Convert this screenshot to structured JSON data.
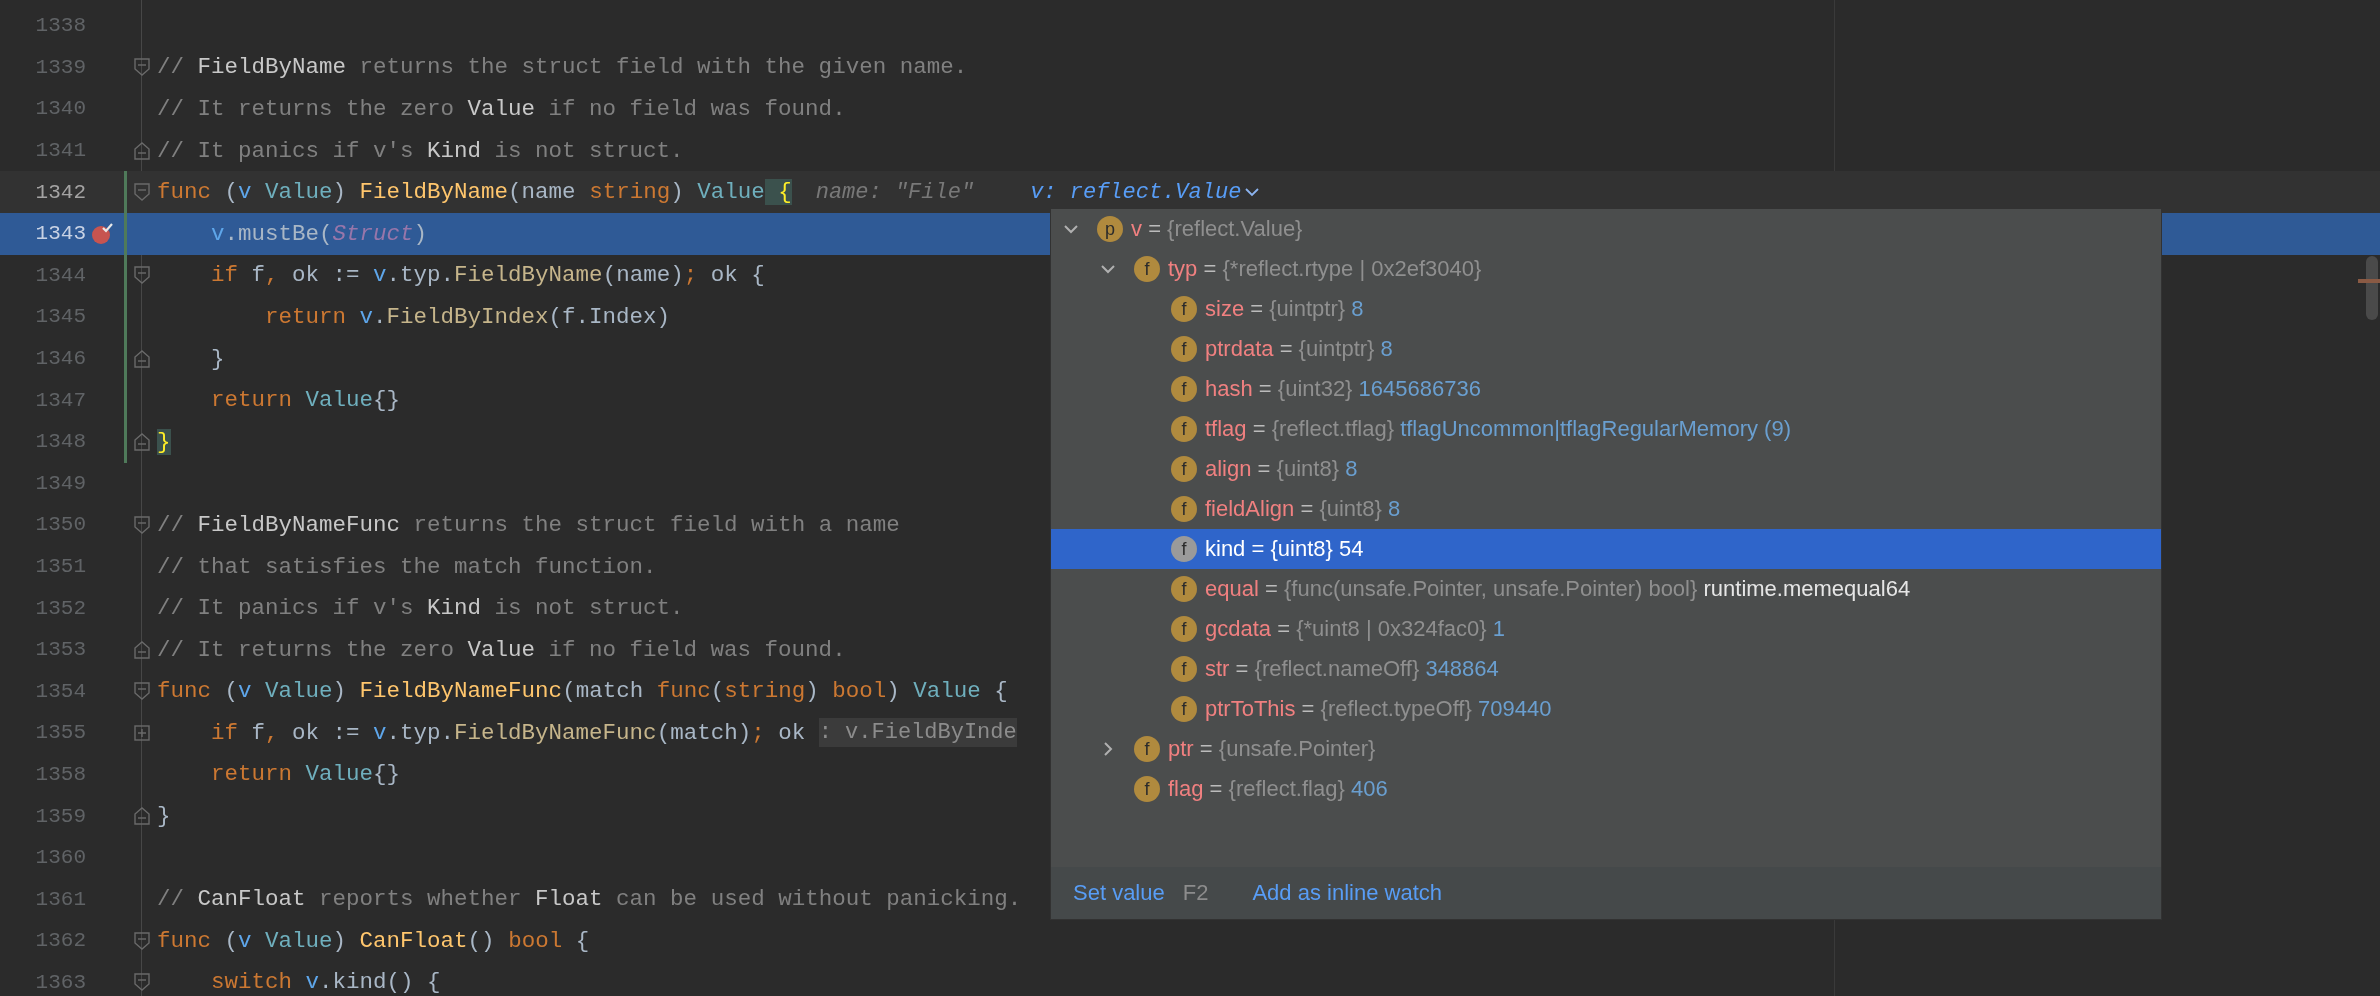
{
  "editor": {
    "lines": [
      {
        "number": "1338"
      },
      {
        "number": "1339",
        "fold_start": true,
        "tokens": [
          {
            "kind": "comment",
            "text": "// "
          },
          {
            "kind": "doc",
            "text": "FieldByName"
          },
          {
            "kind": "comment",
            "text": " returns the struct field with the given name."
          }
        ]
      },
      {
        "number": "1340",
        "tokens": [
          {
            "kind": "comment",
            "text": "// It returns the zero "
          },
          {
            "kind": "doc",
            "text": "Value"
          },
          {
            "kind": "comment",
            "text": " if no field was found."
          }
        ]
      },
      {
        "number": "1341",
        "fold_end": true,
        "tokens": [
          {
            "kind": "comment",
            "text": "// It panics if v's "
          },
          {
            "kind": "doc",
            "text": "Kind"
          },
          {
            "kind": "comment",
            "text": " is not struct."
          }
        ]
      },
      {
        "number": "1342",
        "fold_start": true,
        "changed": true,
        "caret_line": true,
        "tokens": [
          {
            "kind": "keyword",
            "text": "func"
          },
          {
            "kind": "plain",
            "text": " ("
          },
          {
            "kind": "receiver",
            "text": "v"
          },
          {
            "kind": "type",
            "text": " Value"
          },
          {
            "kind": "plain",
            "text": ") "
          },
          {
            "kind": "function",
            "text": "FieldByName"
          },
          {
            "kind": "plain",
            "text": "(name "
          },
          {
            "kind": "keyword",
            "text": "string"
          },
          {
            "kind": "plain",
            "text": ") "
          },
          {
            "kind": "type",
            "text": "Value"
          },
          {
            "kind": "brace",
            "text": " {"
          }
        ],
        "hints": [
          {
            "kind": "param",
            "text": "name: \"File\""
          },
          {
            "kind": "watch",
            "text": "v: reflect.Value"
          }
        ]
      },
      {
        "number": "1343",
        "breakpoint": true,
        "changed": true,
        "execution_point": true,
        "tokens": [
          {
            "kind": "receiver",
            "text": "    v"
          },
          {
            "kind": "plain",
            "text": ".mustBe("
          },
          {
            "kind": "constant",
            "text": "Struct"
          },
          {
            "kind": "plain",
            "text": ")"
          }
        ]
      },
      {
        "number": "1344",
        "fold_start": true,
        "changed": true,
        "tokens": [
          {
            "kind": "keyword",
            "text": "    if"
          },
          {
            "kind": "plain",
            "text": " f"
          },
          {
            "kind": "keyword",
            "text": ","
          },
          {
            "kind": "plain",
            "text": " ok := "
          },
          {
            "kind": "receiver",
            "text": "v"
          },
          {
            "kind": "plain",
            "text": ".typ."
          },
          {
            "kind": "call",
            "text": "FieldByName"
          },
          {
            "kind": "plain",
            "text": "(name)"
          },
          {
            "kind": "keyword",
            "text": ";"
          },
          {
            "kind": "plain",
            "text": " ok {"
          }
        ]
      },
      {
        "number": "1345",
        "changed": true,
        "tokens": [
          {
            "kind": "keyword",
            "text": "        return"
          },
          {
            "kind": "receiver",
            "text": " v"
          },
          {
            "kind": "plain",
            "text": "."
          },
          {
            "kind": "call",
            "text": "FieldByIndex"
          },
          {
            "kind": "plain",
            "text": "(f.Index)"
          }
        ]
      },
      {
        "number": "1346",
        "fold_end": true,
        "changed": true,
        "tokens": [
          {
            "kind": "plain",
            "text": "    }"
          }
        ]
      },
      {
        "number": "1347",
        "changed": true,
        "tokens": [
          {
            "kind": "keyword",
            "text": "    return"
          },
          {
            "kind": "type",
            "text": " Value"
          },
          {
            "kind": "plain",
            "text": "{}"
          }
        ]
      },
      {
        "number": "1348",
        "fold_end": true,
        "changed": true,
        "tokens": [
          {
            "kind": "brace",
            "text": "}"
          }
        ]
      },
      {
        "number": "1349"
      },
      {
        "number": "1350",
        "fold_start": true,
        "tokens": [
          {
            "kind": "comment",
            "text": "// "
          },
          {
            "kind": "doc",
            "text": "FieldByNameFunc"
          },
          {
            "kind": "comment",
            "text": " returns the struct field with a name"
          }
        ]
      },
      {
        "number": "1351",
        "tokens": [
          {
            "kind": "comment",
            "text": "// that satisfies the match function."
          }
        ]
      },
      {
        "number": "1352",
        "tokens": [
          {
            "kind": "comment",
            "text": "// It panics if v's "
          },
          {
            "kind": "doc",
            "text": "Kind"
          },
          {
            "kind": "comment",
            "text": " is not struct."
          }
        ]
      },
      {
        "number": "1353",
        "fold_end": true,
        "tokens": [
          {
            "kind": "comment",
            "text": "// It returns the zero "
          },
          {
            "kind": "doc",
            "text": "Value"
          },
          {
            "kind": "comment",
            "text": " if no field was found."
          }
        ]
      },
      {
        "number": "1354",
        "fold_start": true,
        "tokens": [
          {
            "kind": "keyword",
            "text": "func"
          },
          {
            "kind": "plain",
            "text": " ("
          },
          {
            "kind": "receiver",
            "text": "v"
          },
          {
            "kind": "type",
            "text": " Value"
          },
          {
            "kind": "plain",
            "text": ") "
          },
          {
            "kind": "function",
            "text": "FieldByNameFunc"
          },
          {
            "kind": "plain",
            "text": "(match "
          },
          {
            "kind": "keyword",
            "text": "func"
          },
          {
            "kind": "plain",
            "text": "("
          },
          {
            "kind": "keyword",
            "text": "string"
          },
          {
            "kind": "plain",
            "text": ") "
          },
          {
            "kind": "keyword",
            "text": "bool"
          },
          {
            "kind": "plain",
            "text": ") "
          },
          {
            "kind": "type",
            "text": "Value"
          },
          {
            "kind": "plain",
            "text": " {"
          }
        ]
      },
      {
        "number": "1355",
        "folded": true,
        "tokens": [
          {
            "kind": "keyword",
            "text": "    if"
          },
          {
            "kind": "plain",
            "text": " f"
          },
          {
            "kind": "keyword",
            "text": ","
          },
          {
            "kind": "plain",
            "text": " ok := "
          },
          {
            "kind": "receiver",
            "text": "v"
          },
          {
            "kind": "plain",
            "text": ".typ."
          },
          {
            "kind": "call",
            "text": "FieldByNameFunc"
          },
          {
            "kind": "plain",
            "text": "(match)"
          },
          {
            "kind": "keyword",
            "text": ";"
          },
          {
            "kind": "plain",
            "text": " ok "
          }
        ],
        "hints": [
          {
            "kind": "folded",
            "text": ": v.FieldByInde"
          }
        ]
      },
      {
        "number": "1358",
        "tokens": [
          {
            "kind": "keyword",
            "text": "    return"
          },
          {
            "kind": "type",
            "text": " Value"
          },
          {
            "kind": "plain",
            "text": "{}"
          }
        ]
      },
      {
        "number": "1359",
        "fold_end": true,
        "tokens": [
          {
            "kind": "plain",
            "text": "}"
          }
        ]
      },
      {
        "number": "1360"
      },
      {
        "number": "1361",
        "tokens": [
          {
            "kind": "comment",
            "text": "// "
          },
          {
            "kind": "doc",
            "text": "CanFloat"
          },
          {
            "kind": "comment",
            "text": " reports whether "
          },
          {
            "kind": "doc",
            "text": "Float"
          },
          {
            "kind": "comment",
            "text": " can be used without panicking."
          }
        ]
      },
      {
        "number": "1362",
        "fold_start": true,
        "tokens": [
          {
            "kind": "keyword",
            "text": "func"
          },
          {
            "kind": "plain",
            "text": " ("
          },
          {
            "kind": "receiver",
            "text": "v"
          },
          {
            "kind": "type",
            "text": " Value"
          },
          {
            "kind": "plain",
            "text": ") "
          },
          {
            "kind": "function",
            "text": "CanFloat"
          },
          {
            "kind": "plain",
            "text": "() "
          },
          {
            "kind": "keyword",
            "text": "bool"
          },
          {
            "kind": "plain",
            "text": " {"
          }
        ]
      },
      {
        "number": "1363",
        "fold_start": true,
        "tokens": [
          {
            "kind": "keyword",
            "text": "    switch"
          },
          {
            "kind": "receiver",
            "text": " v"
          },
          {
            "kind": "plain",
            "text": ".kind() {"
          }
        ]
      }
    ]
  },
  "popup": {
    "tree": [
      {
        "badge": "p",
        "name": "v",
        "separator": "=",
        "type": "{reflect.Value}",
        "selected": false,
        "expanded": true,
        "children": [
          {
            "badge": "f",
            "name": "typ",
            "separator": "=",
            "type": "{*reflect.rtype | 0x2ef3040}",
            "selected": false,
            "expanded": true,
            "children": [
              {
                "badge": "f",
                "name": "size",
                "separator": "=",
                "type": "{uintptr}",
                "value": "8",
                "kind": "number",
                "selected": false
              },
              {
                "badge": "f",
                "name": "ptrdata",
                "separator": "=",
                "type": "{uintptr}",
                "value": "8",
                "kind": "number",
                "selected": false
              },
              {
                "badge": "f",
                "name": "hash",
                "separator": "=",
                "type": "{uint32}",
                "value": "1645686736",
                "kind": "number",
                "selected": false
              },
              {
                "badge": "f",
                "name": "tflag",
                "separator": "=",
                "type": "{reflect.tflag}",
                "value": "tflagUncommon|tflagRegularMemory (9)",
                "kind": "number",
                "selected": false
              },
              {
                "badge": "f",
                "name": "align",
                "separator": "=",
                "type": "{uint8}",
                "value": "8",
                "kind": "number",
                "selected": false
              },
              {
                "badge": "f",
                "name": "fieldAlign",
                "separator": "=",
                "type": "{uint8}",
                "value": "8",
                "kind": "number",
                "selected": false
              },
              {
                "badge": "f",
                "name": "kind",
                "separator": "=",
                "type": "{uint8}",
                "value": "54",
                "kind": "number",
                "selected": true
              },
              {
                "badge": "f",
                "name": "equal",
                "separator": "=",
                "type": "{func(unsafe.Pointer, unsafe.Pointer) bool}",
                "value": "runtime.memequal64",
                "kind": "symbol",
                "selected": false
              },
              {
                "badge": "f",
                "name": "gcdata",
                "separator": "=",
                "type": "{*uint8 | 0x324fac0}",
                "value": "1",
                "kind": "number",
                "selected": false
              },
              {
                "badge": "f",
                "name": "str",
                "separator": "=",
                "type": "{reflect.nameOff}",
                "value": "348864",
                "kind": "number",
                "selected": false
              },
              {
                "badge": "f",
                "name": "ptrToThis",
                "separator": "=",
                "type": "{reflect.typeOff}",
                "value": "709440",
                "kind": "number",
                "selected": false
              }
            ]
          },
          {
            "badge": "f",
            "name": "ptr",
            "separator": "=",
            "type": "{unsafe.Pointer}",
            "selected": false,
            "expanded": false
          },
          {
            "badge": "f",
            "name": "flag",
            "separator": "=",
            "type": "{reflect.flag}",
            "value": "406",
            "kind": "number",
            "selected": false
          }
        ]
      }
    ],
    "actions": [
      {
        "label": "Set value",
        "shortcut": "F2"
      },
      {
        "label": "Add as inline watch"
      }
    ]
  }
}
